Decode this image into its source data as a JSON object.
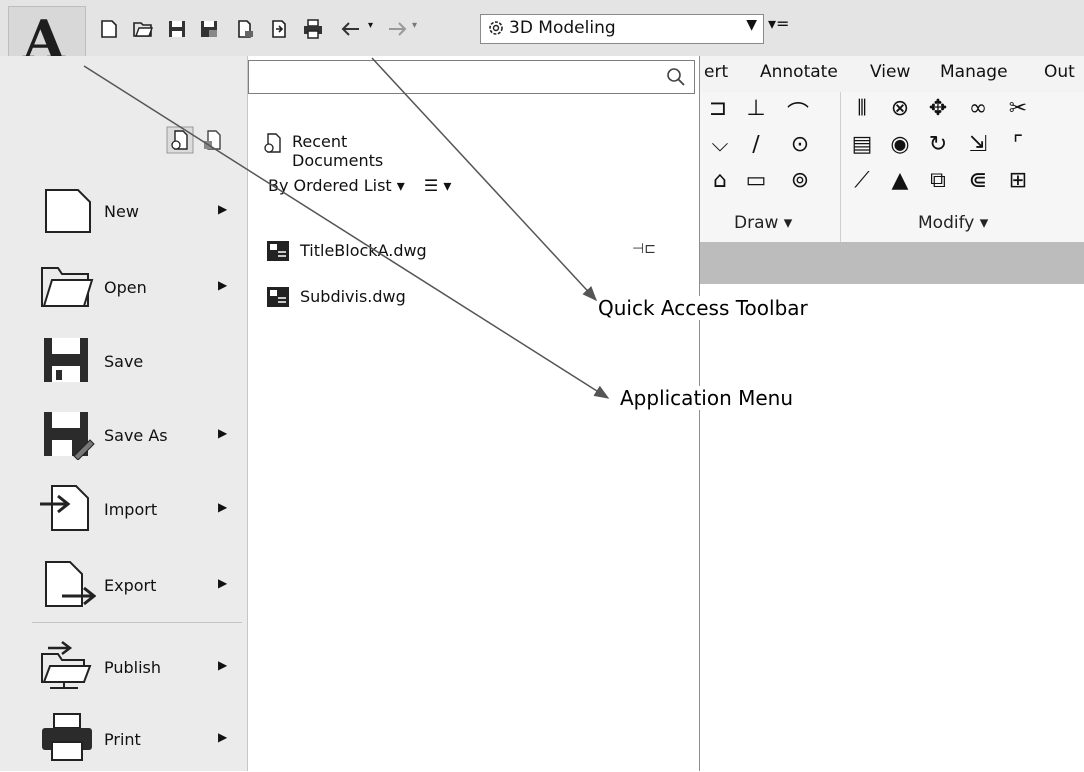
{
  "app_button": {
    "letter": "A"
  },
  "qat": {
    "icons": [
      "new-icon",
      "open-icon",
      "save-icon",
      "save-as-icon",
      "publish-icon",
      "plot-icon",
      "print-icon",
      "undo-icon",
      "redo-icon"
    ],
    "workspace": "3D Modeling",
    "customize": "▾="
  },
  "ribbon": {
    "tabs": [
      "ert",
      "Annotate",
      "View",
      "Manage",
      "Out"
    ],
    "panels": [
      {
        "label": "Draw ▾"
      },
      {
        "label": "Modify ▾"
      }
    ]
  },
  "menu": {
    "search": {
      "value": "",
      "placeholder": ""
    },
    "items": [
      {
        "label": "New",
        "has_submenu": true
      },
      {
        "label": "Open",
        "has_submenu": true
      },
      {
        "label": "Save",
        "has_submenu": false
      },
      {
        "label": "Save As",
        "has_submenu": true
      },
      {
        "label": "Import",
        "has_submenu": true
      },
      {
        "label": "Export",
        "has_submenu": true
      },
      {
        "label": "Publish",
        "has_submenu": true
      },
      {
        "label": "Print",
        "has_submenu": true
      }
    ],
    "submenu_arrow": "▶",
    "recent": {
      "title": "Recent Documents",
      "ordering": "By Ordered List ▾",
      "view_menu": "☰ ▾",
      "documents": [
        "TitleBlockA.dwg",
        "Subdivis.dwg"
      ],
      "pin": "⊣⊏"
    }
  },
  "callouts": {
    "quick_access": "Quick Access Toolbar",
    "application_menu": "Application Menu"
  }
}
